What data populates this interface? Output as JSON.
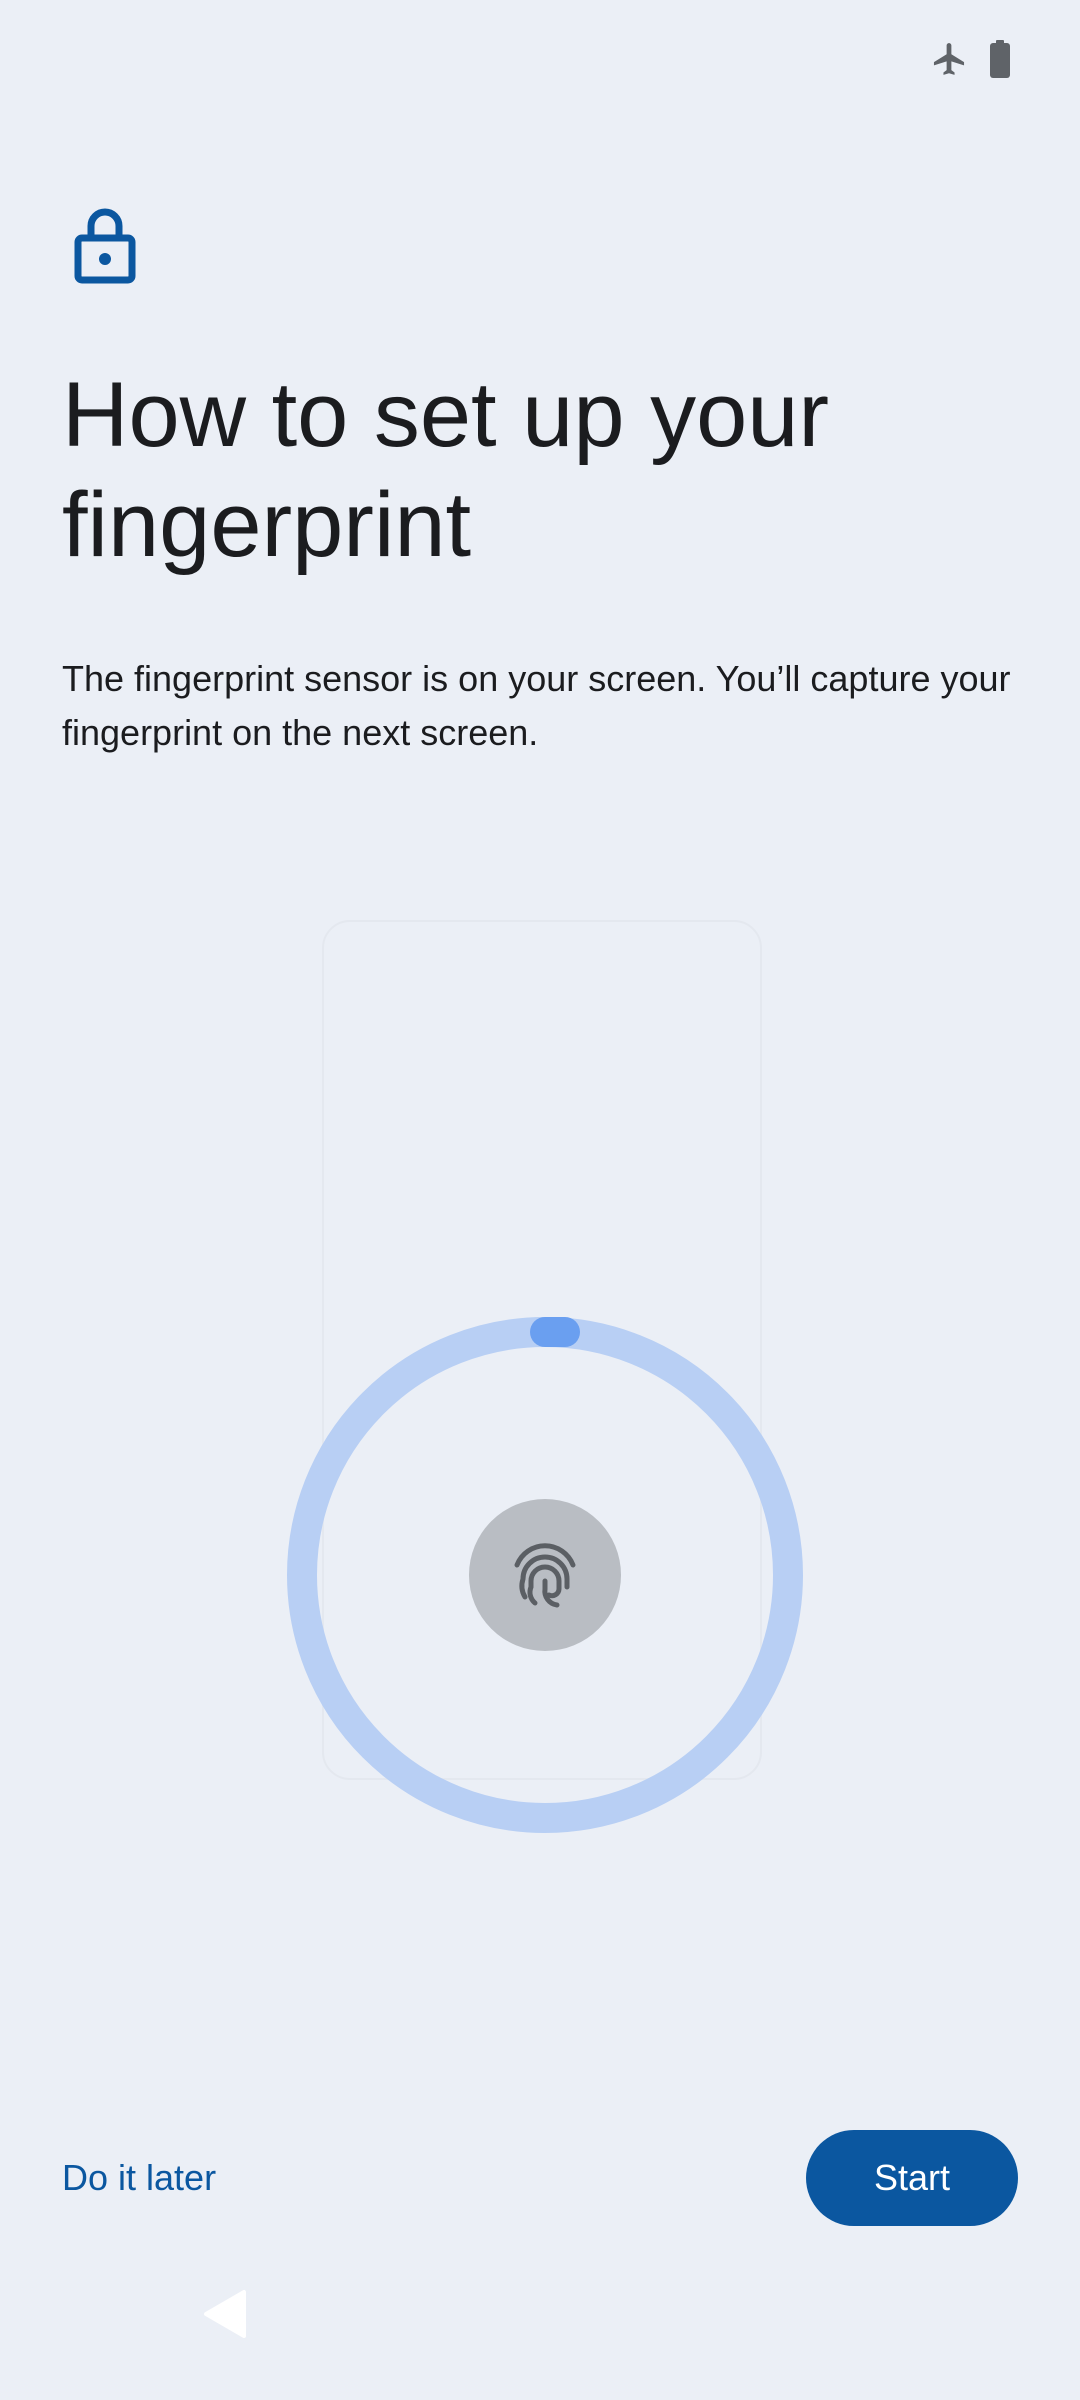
{
  "status_bar": {
    "icons": [
      "airplane-mode-icon",
      "battery-icon"
    ]
  },
  "header": {
    "icon": "lock-icon",
    "title": "How to set up your fingerprint",
    "description": "The fingerprint sensor is on your screen. You’ll capture your fingerprint on the next screen."
  },
  "illustration": {
    "icons": [
      "phone-outline",
      "progress-ring",
      "fingerprint-icon"
    ],
    "colors": {
      "ring": "#b8cff4",
      "ring_indicator": "#6a9ff0",
      "sensor": "#b9bdc3",
      "fingerprint": "#5b5f64"
    }
  },
  "footer": {
    "secondary_label": "Do it later",
    "primary_label": "Start"
  },
  "nav_bar": {
    "icons": [
      "back-icon"
    ]
  },
  "colors": {
    "background": "#ebeff6",
    "accent": "#0b57a0",
    "text": "#1b1c1f"
  }
}
